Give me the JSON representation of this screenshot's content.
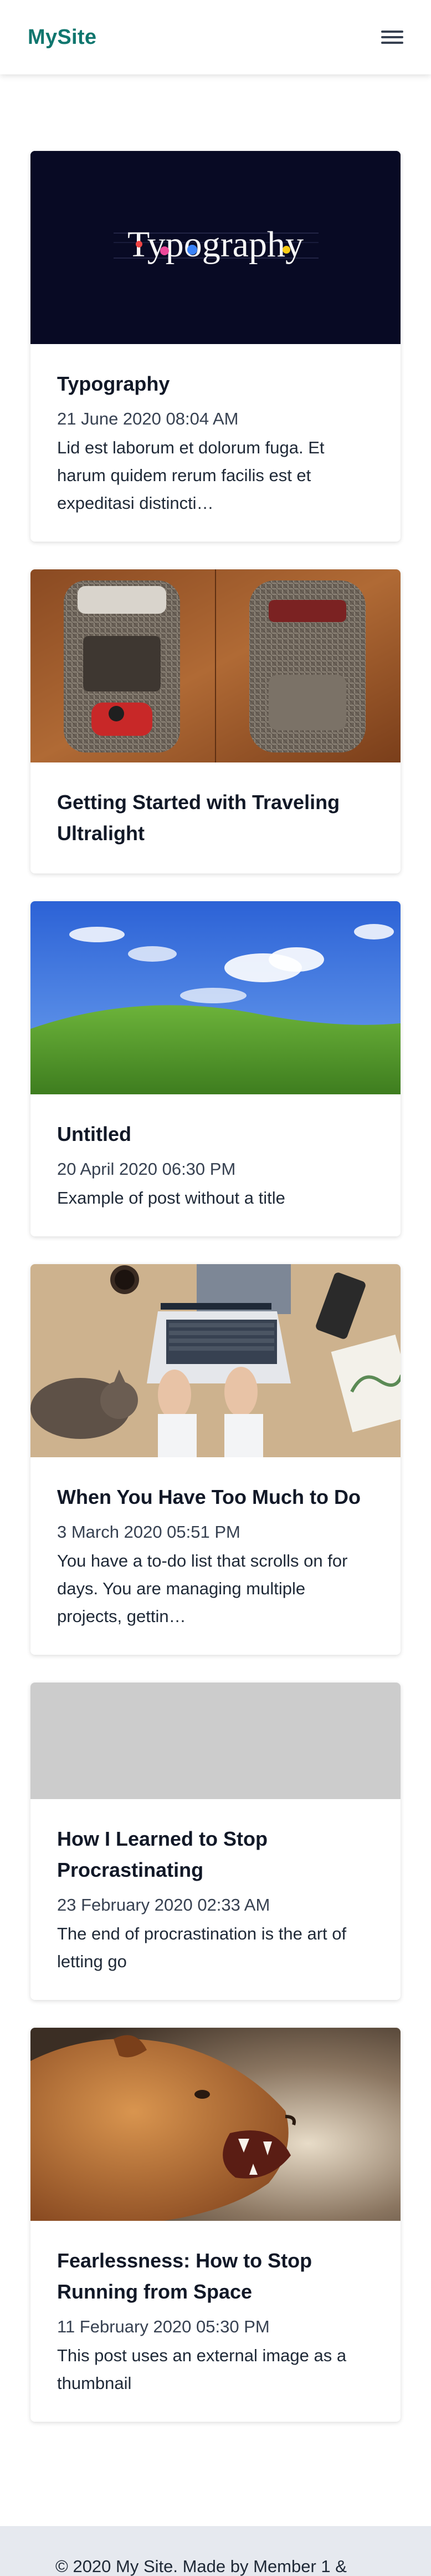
{
  "site": {
    "brand": "MySite",
    "menu_icon": "hamburger-menu-icon"
  },
  "posts": [
    {
      "title": "Typography",
      "date": "21 June 2020 08:04 AM",
      "excerpt": "Lid est laborum et dolorum fuga. Et harum quidem rerum facilis est et expeditasi distincti…",
      "thumb_text": "Typography"
    },
    {
      "title": "Getting Started with Traveling Ultralight",
      "date": "",
      "excerpt": ""
    },
    {
      "title": "Untitled",
      "date": "20 April 2020 06:30 PM",
      "excerpt": "Example of post without a title"
    },
    {
      "title": "When You Have Too Much to Do",
      "date": "3 March 2020 05:51 PM",
      "excerpt": "You have a to-do list that scrolls on for days. You are managing multiple projects, gettin…"
    },
    {
      "title": "How I Learned to Stop Procrastinating",
      "date": "23 February 2020 02:33 AM",
      "excerpt": "The end of procrastination is the art of letting go"
    },
    {
      "title": "Fearlessness: How to Stop Running from Space",
      "date": "11 February 2020 05:30 PM",
      "excerpt": "This post uses an external image as a thumbnail"
    }
  ],
  "footer": {
    "text": "© 2020 My Site. Made by Member 1 &"
  },
  "colors": {
    "brand": "#0f766e",
    "footer_bg": "#e6e9ef"
  }
}
